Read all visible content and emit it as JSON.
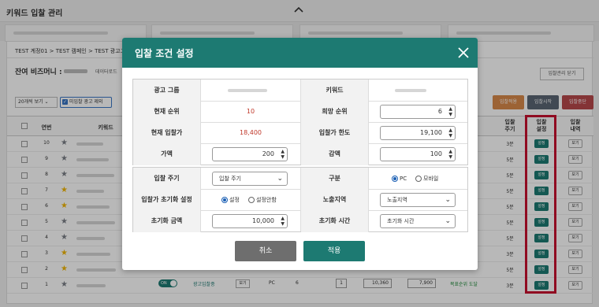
{
  "page": {
    "title": "키워드 입찰 관리"
  },
  "breadcrumb": [
    "TEST 계정01",
    "TEST 캠페인",
    "TEST 광고그룹"
  ],
  "balance_label": "잔여 비즈머니 :",
  "data_load_label": "데이터로드",
  "close_bidding_label": "입찰관리 닫기",
  "toolbar": {
    "page_size": "20개씩 보기",
    "exclude_unbid": "미입찰 광고 제외",
    "bid_apply": "입찰적용",
    "bid_start": "입찰시작",
    "bid_stop": "입찰중단"
  },
  "table": {
    "headers": {
      "no": "연번",
      "keyword": "키워드",
      "cycle": "입찰\n주기",
      "setting": "입찰\n설정",
      "history": "입찰\n내역"
    },
    "rows": [
      {
        "no": "10",
        "star": "gray",
        "cycle": "3분"
      },
      {
        "no": "9",
        "star": "gray",
        "cycle": "5분"
      },
      {
        "no": "8",
        "star": "gray",
        "cycle": "5분"
      },
      {
        "no": "7",
        "star": "yellow",
        "cycle": "5분"
      },
      {
        "no": "6",
        "star": "yellow",
        "cycle": "5분"
      },
      {
        "no": "5",
        "star": "gray",
        "cycle": "5분"
      },
      {
        "no": "4",
        "star": "gray",
        "cycle": "5분"
      },
      {
        "no": "3",
        "star": "yellow",
        "cycle": "3분"
      },
      {
        "no": "2",
        "star": "yellow",
        "cycle": "5분"
      },
      {
        "no": "1",
        "star": "gray",
        "cycle": "3분"
      }
    ],
    "row_setting_label": "설정",
    "row_view_label": "보기",
    "last_row": {
      "toggle": "ON",
      "status": "광고입찰중",
      "view": "보기",
      "device": "PC",
      "rank": "6",
      "current": "1",
      "bid": "10,360",
      "limit": "7,900",
      "result": "목표순위 도달"
    },
    "stars": {
      "yellow": "#f2b600",
      "gray": "#7a7f87"
    }
  },
  "modal": {
    "title": "입찰 조건 설정",
    "ad_group_label": "광고 그룹",
    "keyword_label": "키워드",
    "current_rank_label": "현재 순위",
    "current_rank_value": "10",
    "target_rank_label": "희망 순위",
    "target_rank_value": "6",
    "current_bid_label": "현재 입찰가",
    "current_bid_value": "18,400",
    "bid_limit_label": "입찰가 한도",
    "bid_limit_value": "19,100",
    "increase_label": "가액",
    "increase_value": "200",
    "decrease_label": "감액",
    "decrease_value": "100",
    "cycle_label": "입찰 주기",
    "cycle_value": "입찰 주기",
    "device_label": "구분",
    "device_pc": "PC",
    "device_mobile": "모바일",
    "reset_label": "입찰가 초기화 설정",
    "reset_on": "설정",
    "reset_off": "설정안함",
    "exposure_label": "노출지역",
    "exposure_value": "노출지역",
    "reset_amount_label": "초기화 금액",
    "reset_amount_value": "10,000",
    "reset_time_label": "초기화 시간",
    "reset_time_value": "초기화 시간",
    "cancel": "취소",
    "apply": "적용",
    "accent": "#1d7a72",
    "red_text": "#c0392b"
  }
}
